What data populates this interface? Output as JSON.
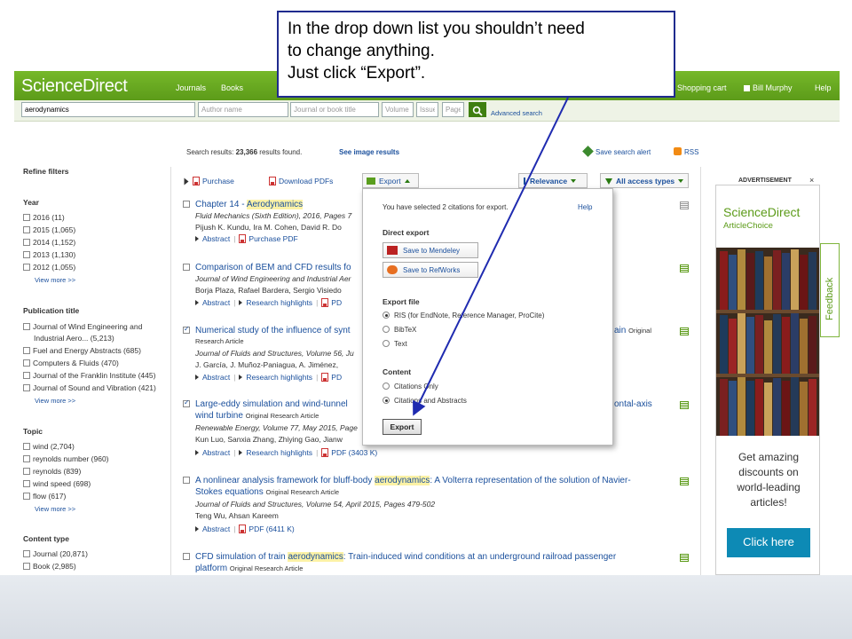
{
  "callout": {
    "line1": "In the drop down list you shouldn’t need",
    "line2": "to change anything.",
    "line3": "Just click “Export”."
  },
  "topbar": {
    "logo": "ScienceDirect",
    "journals": "Journals",
    "books": "Books",
    "cart": "Shopping cart",
    "user": "Bill Murphy",
    "help": "Help"
  },
  "search": {
    "query": "aerodynamics",
    "author_placeholder": "Author name",
    "journal_placeholder": "Journal or book title",
    "volume_placeholder": "Volume",
    "issue_placeholder": "Issue",
    "page_placeholder": "Page",
    "advanced": "Advanced search"
  },
  "results_header": {
    "prefix": "Search results:",
    "count": "23,366",
    "suffix": "results found.",
    "image_results": "See image results",
    "save_alert": "Save search alert",
    "rss": "RSS"
  },
  "filters": {
    "title": "Refine filters",
    "year": {
      "title": "Year",
      "items": [
        "2016  (11)",
        "2015  (1,065)",
        "2014  (1,152)",
        "2013  (1,130)",
        "2012  (1,055)"
      ],
      "more": "View more >>"
    },
    "publication": {
      "title": "Publication title",
      "items": [
        "Journal of Wind Engineering and",
        "Industrial Aero...  (5,213)",
        "Fuel and Energy Abstracts  (685)",
        "Computers & Fluids  (470)",
        "Journal of the Franklin Institute  (445)",
        "Journal of Sound and Vibration  (421)"
      ],
      "more": "View more >>"
    },
    "topic": {
      "title": "Topic",
      "items": [
        "wind  (2,704)",
        "reynolds number  (960)",
        "reynolds  (839)",
        "wind speed  (698)",
        "flow  (617)"
      ],
      "more": "View more >>"
    },
    "content": {
      "title": "Content type",
      "items": [
        "Journal  (20,871)",
        "Book  (2,985)"
      ]
    }
  },
  "toolbar": {
    "purchase": "Purchase",
    "download": "Download PDFs",
    "export": "Export",
    "relevance": "Relevance",
    "access": "All access types"
  },
  "results": [
    {
      "title_pre": "Chapter 14 - ",
      "title_hl": "Aerodynamics",
      "line1": "Fluid Mechanics (Sixth Edition), 2016, Pages 7",
      "line2": "Pijush K. Kundu, Ira M. Cohen, David R. Do",
      "links": [
        "Abstract",
        "Purchase PDF"
      ]
    },
    {
      "title_pre": "Comparison of BEM and CFD results fo",
      "line1": "Journal of Wind Engineering and Industrial Aer",
      "line2": "Borja Plaza, Rafael Bardera, Sergio Visiedo",
      "links": [
        "Abstract",
        "Research highlights",
        "PD"
      ]
    },
    {
      "title_pre": "Numerical study of the influence of synt",
      "title_tail": "ain",
      "rtype": "Original",
      "line0": "Research Article",
      "line1": "Journal of Fluids and Structures, Volume 56, Ju",
      "line2": "J. García, J. Muñoz-Paniagua, A. Jiménez,",
      "links": [
        "Abstract",
        "Research highlights",
        "PD"
      ]
    },
    {
      "title_pre": "Large-eddy simulation and wind-tunnel",
      "title_tail": "ontal-axis",
      "title2": "wind turbine",
      "rtype": "Original Research Article",
      "line1": "Renewable Energy, Volume 77, May 2015, Page",
      "line2": "Kun Luo, Sanxia Zhang, Zhiying Gao, Jianw",
      "links": [
        "Abstract",
        "Research highlights",
        "PDF (3403 K)"
      ]
    },
    {
      "title_pre": "A nonlinear analysis framework for bluff-body ",
      "title_hl": "aerodynamics",
      "title_post": ": A Volterra representation of the solution of Navier-",
      "title2": "Stokes equations",
      "rtype": "Original Research Article",
      "line1": "Journal of Fluids and Structures, Volume 54, April 2015, Pages 479-502",
      "line2": "Teng Wu, Ahsan Kareem",
      "links": [
        "Abstract",
        "PDF (6411 K)"
      ]
    },
    {
      "title_pre": "CFD simulation of train ",
      "title_hl": "aerodynamics",
      "title_post": ": Train-induced wind conditions at an underground railroad passenger",
      "title2": "platform",
      "rtype": "Original Research Article"
    }
  ],
  "popup": {
    "head": "You have selected 2 citations for export.",
    "help": "Help",
    "direct": "Direct export",
    "mendeley": "Save to Mendeley",
    "refworks": "Save to RefWorks",
    "file": "Export file",
    "ris": "RIS (for EndNote, Reference Manager, ProCite)",
    "bibtex": "BibTeX",
    "text": "Text",
    "content": "Content",
    "citations_only": "Citations Only",
    "citations_abstracts": "Citations and Abstracts",
    "export_btn": "Export",
    "selected_format": "RIS (for EndNote, Reference Manager, ProCite)",
    "selected_content": "Citations and Abstracts"
  },
  "ad": {
    "label": "ADVERTISEMENT",
    "close": "×",
    "brand": "ScienceDirect",
    "sub": "ArticleChoice",
    "text1": "Get amazing",
    "text2": "discounts on",
    "text3": "world-leading",
    "text4": "articles!",
    "button": "Click here"
  },
  "feedback": "Feedback",
  "colors": {
    "brand_green": "#5c9b19",
    "link_blue": "#1a4f9c",
    "callout_border": "#1f2b8e",
    "highlight": "#fcf2a6"
  }
}
